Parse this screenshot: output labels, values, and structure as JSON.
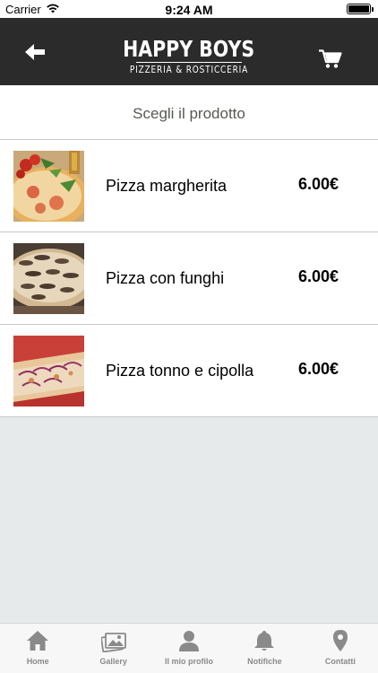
{
  "status_bar": {
    "carrier": "Carrier",
    "time": "9:24 AM",
    "battery_level": 1.0
  },
  "header": {
    "back_icon": "arrow-left-icon",
    "brand_name": "HAPPY BOYS",
    "brand_tagline": "PIZZERIA & ROSTICCERIA",
    "cart_icon": "cart-icon",
    "background_color": "#2b2b2b"
  },
  "section": {
    "title": "Scegli il prodotto"
  },
  "products": [
    {
      "name": "Pizza margherita",
      "price": "6.00€",
      "image": "pizza-margherita-photo"
    },
    {
      "name": "Pizza con funghi",
      "price": "6.00€",
      "image": "pizza-funghi-photo"
    },
    {
      "name": "Pizza tonno e cipolla",
      "price": "6.00€",
      "image": "pizza-tonno-cipolla-photo"
    }
  ],
  "tab_bar": {
    "items": [
      {
        "label": "Home",
        "icon": "home-icon"
      },
      {
        "label": "Gallery",
        "icon": "gallery-icon"
      },
      {
        "label": "Il mio profilo",
        "icon": "profile-icon"
      },
      {
        "label": "Notifiche",
        "icon": "bell-icon"
      },
      {
        "label": "Contatti",
        "icon": "location-pin-icon"
      }
    ],
    "icon_color": "#8a8a8a"
  }
}
